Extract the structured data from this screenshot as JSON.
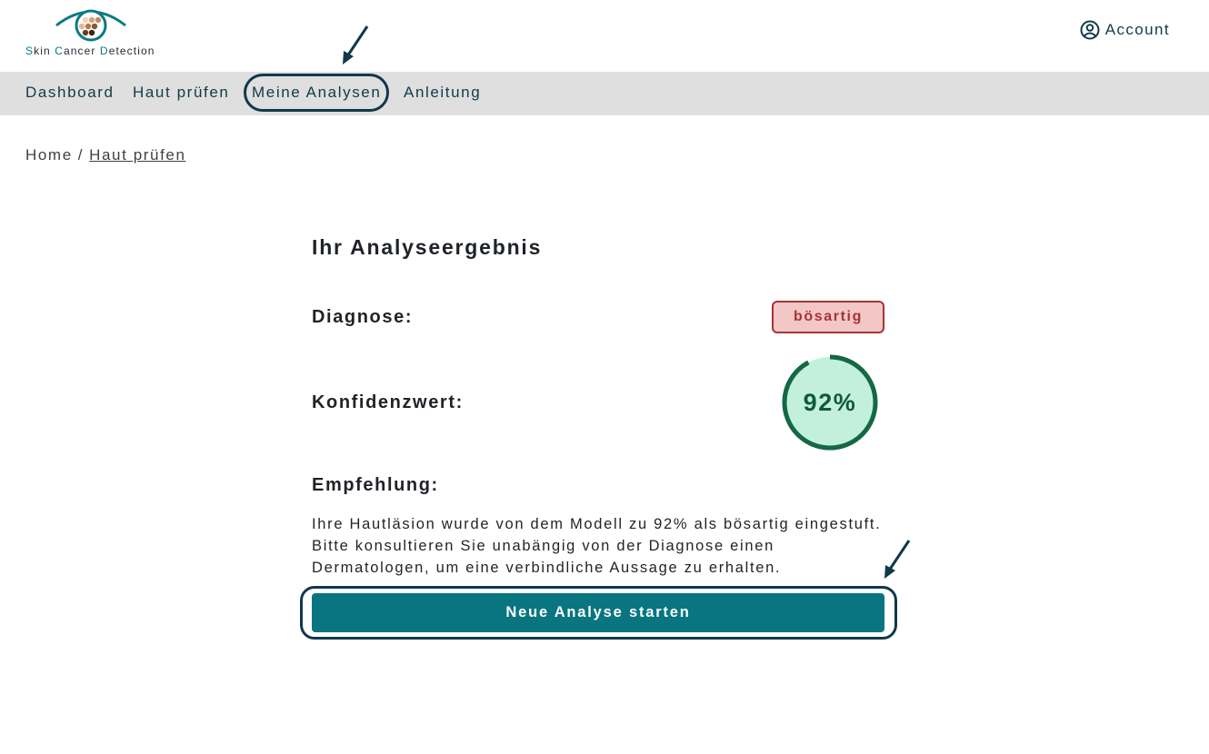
{
  "brand": {
    "logo_text_parts": [
      "S",
      "kin ",
      "C",
      "ancer ",
      "D",
      "etection"
    ],
    "accent_color": "#0b7a84"
  },
  "header": {
    "account_label": "Account",
    "account_icon": "user-circle-icon"
  },
  "nav": {
    "items": [
      {
        "label": "Dashboard"
      },
      {
        "label": "Haut prüfen"
      },
      {
        "label": "Meine Analysen",
        "highlighted": true
      },
      {
        "label": "Anleitung"
      }
    ]
  },
  "breadcrumb": {
    "home": "Home",
    "separator": "/",
    "current": "Haut prüfen"
  },
  "result": {
    "title": "Ihr Analyseergebnis",
    "diagnosis_label": "Diagnose:",
    "diagnosis_value": "bösartig",
    "diagnosis_color": "#a83234",
    "confidence_label": "Konfidenzwert:",
    "confidence_text": "92%",
    "confidence_fraction": 0.92,
    "confidence_color": "#146844",
    "recommendation_label": "Empfehlung:",
    "recommendation_text": "Ihre Hautläsion wurde von dem Modell zu 92% als bösartig eingestuft. Bitte konsultieren Sie unabängig von der Diagnose einen Dermatologen, um eine verbindliche Aussage zu erhalten.",
    "button_label": "Neue Analyse starten",
    "button_color": "#087580"
  }
}
